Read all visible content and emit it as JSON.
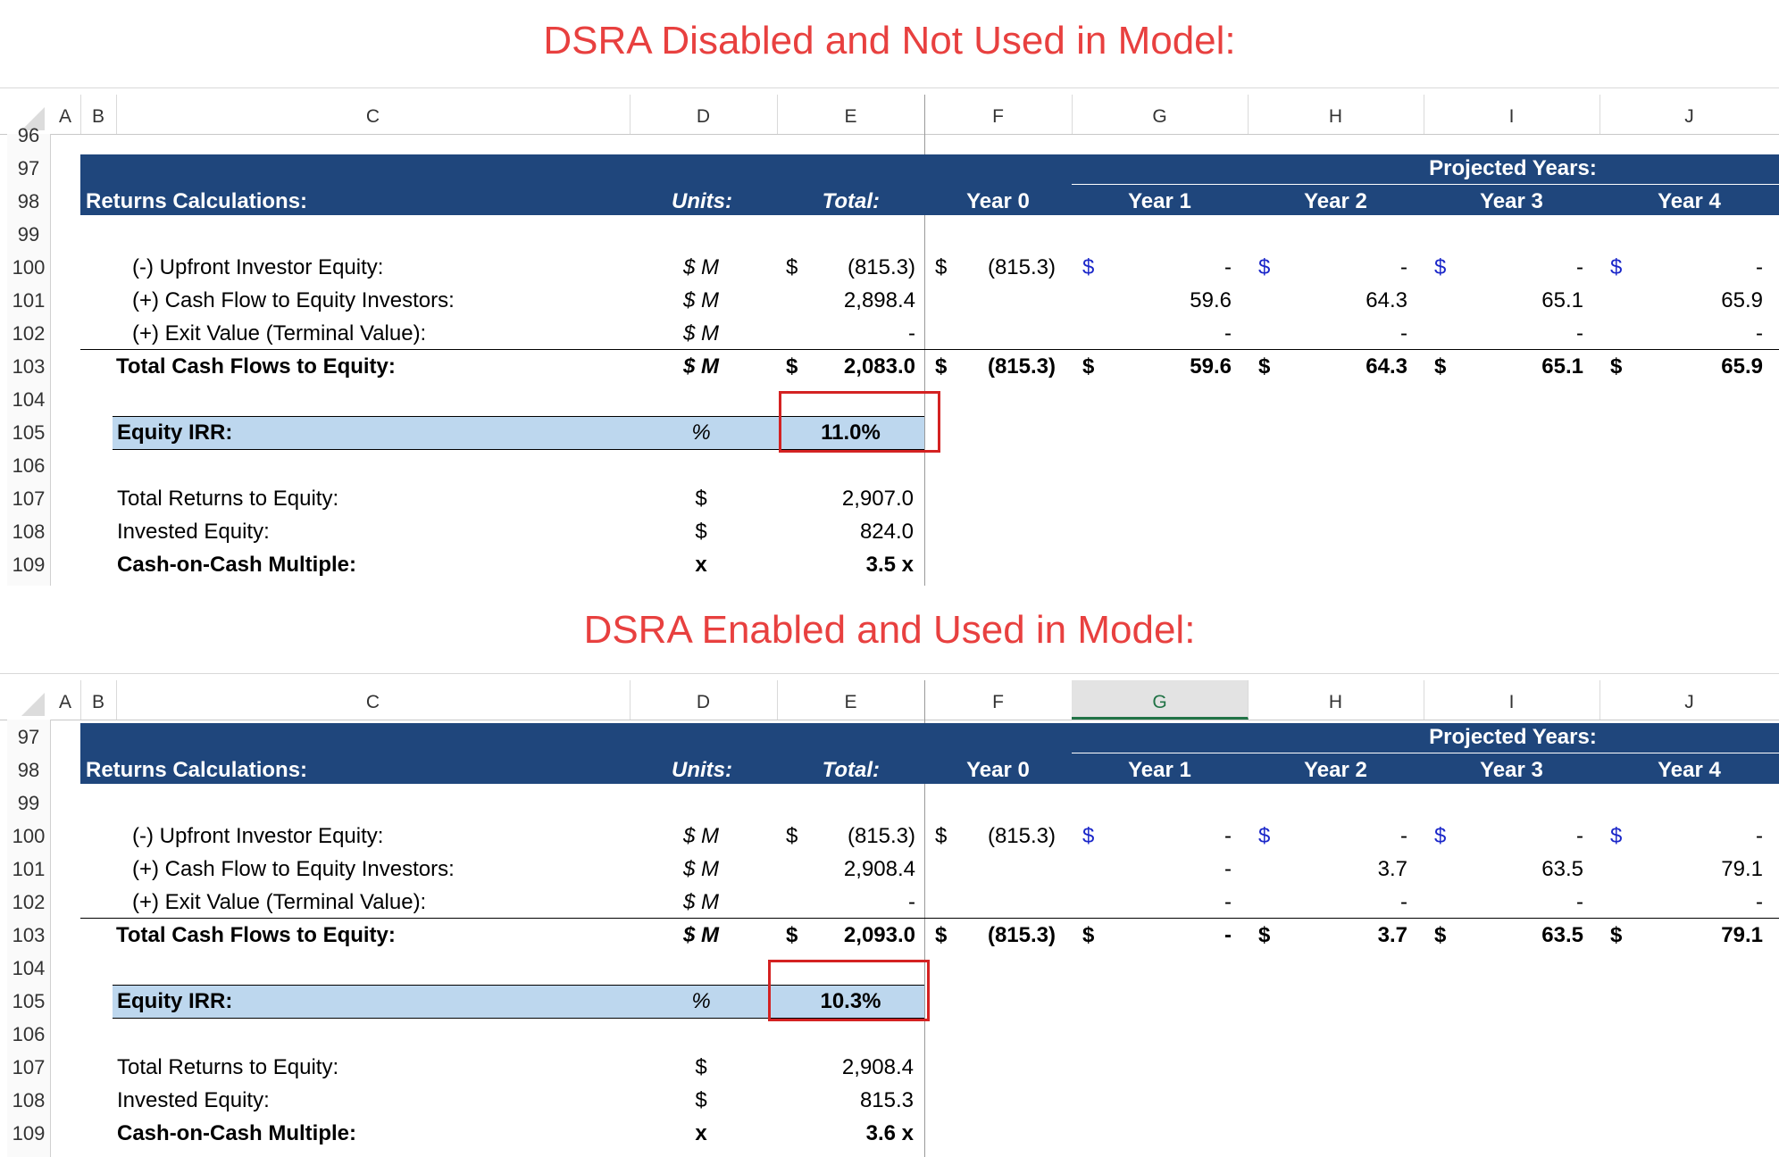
{
  "panels": [
    {
      "title": "DSRA Disabled and Not Used in Model:",
      "columns": [
        "A",
        "B",
        "C",
        "D",
        "E",
        "F",
        "G",
        "H",
        "I",
        "J"
      ],
      "selected_column": "",
      "row_numbers": [
        "96",
        "97",
        "98",
        "99",
        "100",
        "101",
        "102",
        "103",
        "104",
        "105",
        "106",
        "107",
        "108",
        "109"
      ],
      "header": {
        "section": "Returns Calculations:",
        "units": "Units:",
        "total": "Total:",
        "projected": "Projected Years:",
        "years": [
          "Year 0",
          "Year 1",
          "Year 2",
          "Year 3",
          "Year 4"
        ]
      },
      "rows": {
        "upfront": {
          "label": "(-) Upfront Investor Equity:",
          "units": "$ M",
          "total_sym": "$",
          "total": "(815.3)",
          "y0_sym": "$",
          "y0": "(815.3)",
          "y1_sym": "$",
          "y1": "-",
          "y2_sym": "$",
          "y2": "-",
          "y3_sym": "$",
          "y3": "-",
          "y4_sym": "$",
          "y4": "-"
        },
        "cashflow": {
          "label": "(+) Cash Flow to Equity Investors:",
          "units": "$ M",
          "total": "2,898.4",
          "y1": "59.6",
          "y2": "64.3",
          "y3": "65.1",
          "y4": "65.9"
        },
        "exit": {
          "label": "(+) Exit Value (Terminal Value):",
          "units": "$ M",
          "total": "-",
          "y1": "-",
          "y2": "-",
          "y3": "-",
          "y4": "-"
        },
        "totalcf": {
          "label": "Total Cash Flows to Equity:",
          "units": "$ M",
          "total_sym": "$",
          "total": "2,083.0",
          "y0_sym": "$",
          "y0": "(815.3)",
          "y1_sym": "$",
          "y1": "59.6",
          "y2_sym": "$",
          "y2": "64.3",
          "y3_sym": "$",
          "y3": "65.1",
          "y4_sym": "$",
          "y4": "65.9"
        },
        "irr": {
          "label": "Equity IRR:",
          "units": "%",
          "value": "11.0%"
        },
        "returns": {
          "label": "Total Returns to Equity:",
          "units": "$",
          "value": "2,907.0"
        },
        "invested": {
          "label": "Invested Equity:",
          "units": "$",
          "value": "824.0"
        },
        "multiple": {
          "label": "Cash-on-Cash Multiple:",
          "units": "x",
          "value": "3.5 x"
        }
      }
    },
    {
      "title": "DSRA Enabled and Used in Model:",
      "columns": [
        "A",
        "B",
        "C",
        "D",
        "E",
        "F",
        "G",
        "H",
        "I",
        "J"
      ],
      "selected_column": "G",
      "row_numbers": [
        "97",
        "98",
        "99",
        "100",
        "101",
        "102",
        "103",
        "104",
        "105",
        "106",
        "107",
        "108",
        "109"
      ],
      "header": {
        "section": "Returns Calculations:",
        "units": "Units:",
        "total": "Total:",
        "projected": "Projected Years:",
        "years": [
          "Year 0",
          "Year 1",
          "Year 2",
          "Year 3",
          "Year 4"
        ]
      },
      "rows": {
        "upfront": {
          "label": "(-) Upfront Investor Equity:",
          "units": "$ M",
          "total_sym": "$",
          "total": "(815.3)",
          "y0_sym": "$",
          "y0": "(815.3)",
          "y1_sym": "$",
          "y1": "-",
          "y2_sym": "$",
          "y2": "-",
          "y3_sym": "$",
          "y3": "-",
          "y4_sym": "$",
          "y4": "-"
        },
        "cashflow": {
          "label": "(+) Cash Flow to Equity Investors:",
          "units": "$ M",
          "total": "2,908.4",
          "y1": "-",
          "y2": "3.7",
          "y3": "63.5",
          "y4": "79.1"
        },
        "exit": {
          "label": "(+) Exit Value (Terminal Value):",
          "units": "$ M",
          "total": "-",
          "y1": "-",
          "y2": "-",
          "y3": "-",
          "y4": "-"
        },
        "totalcf": {
          "label": "Total Cash Flows to Equity:",
          "units": "$ M",
          "total_sym": "$",
          "total": "2,093.0",
          "y0_sym": "$",
          "y0": "(815.3)",
          "y1_sym": "$",
          "y1": "-",
          "y2_sym": "$",
          "y2": "3.7",
          "y3_sym": "$",
          "y3": "63.5",
          "y4_sym": "$",
          "y4": "79.1"
        },
        "irr": {
          "label": "Equity IRR:",
          "units": "%",
          "value": "10.3%"
        },
        "returns": {
          "label": "Total Returns to Equity:",
          "units": "$",
          "value": "2,908.4"
        },
        "invested": {
          "label": "Invested Equity:",
          "units": "$",
          "value": "815.3"
        },
        "multiple": {
          "label": "Cash-on-Cash Multiple:",
          "units": "x",
          "value": "3.6 x"
        }
      }
    }
  ],
  "colors": {
    "title": "#e8403f",
    "header_band": "#1f467c",
    "irr_band": "#bdd7ee",
    "highlight_box": "#d42222",
    "dollar_blue": "#1a26c9"
  }
}
